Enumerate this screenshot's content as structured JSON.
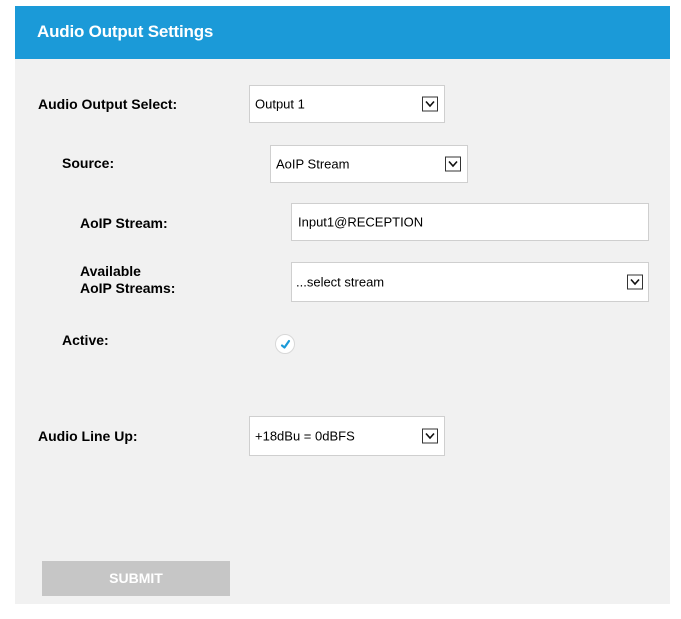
{
  "header": {
    "title": "Audio Output Settings"
  },
  "form": {
    "output_select": {
      "label": "Audio Output Select:",
      "value": "Output 1"
    },
    "source": {
      "label": "Source:",
      "value": "AoIP Stream"
    },
    "aoip_stream": {
      "label": "AoIP Stream:",
      "value": "Input1@RECEPTION"
    },
    "available_streams": {
      "label_line1": "Available",
      "label_line2": "AoIP Streams:",
      "value": "...select stream"
    },
    "active": {
      "label": "Active:",
      "checked": true
    },
    "line_up": {
      "label": "Audio Line Up:",
      "value": "+18dBu = 0dBFS"
    }
  },
  "submit": {
    "label": "SUBMIT"
  },
  "colors": {
    "header": "#1b9ad8",
    "panel": "#f1f1f1",
    "check": "#1b9ad8",
    "submit": "#c6c6c6"
  }
}
